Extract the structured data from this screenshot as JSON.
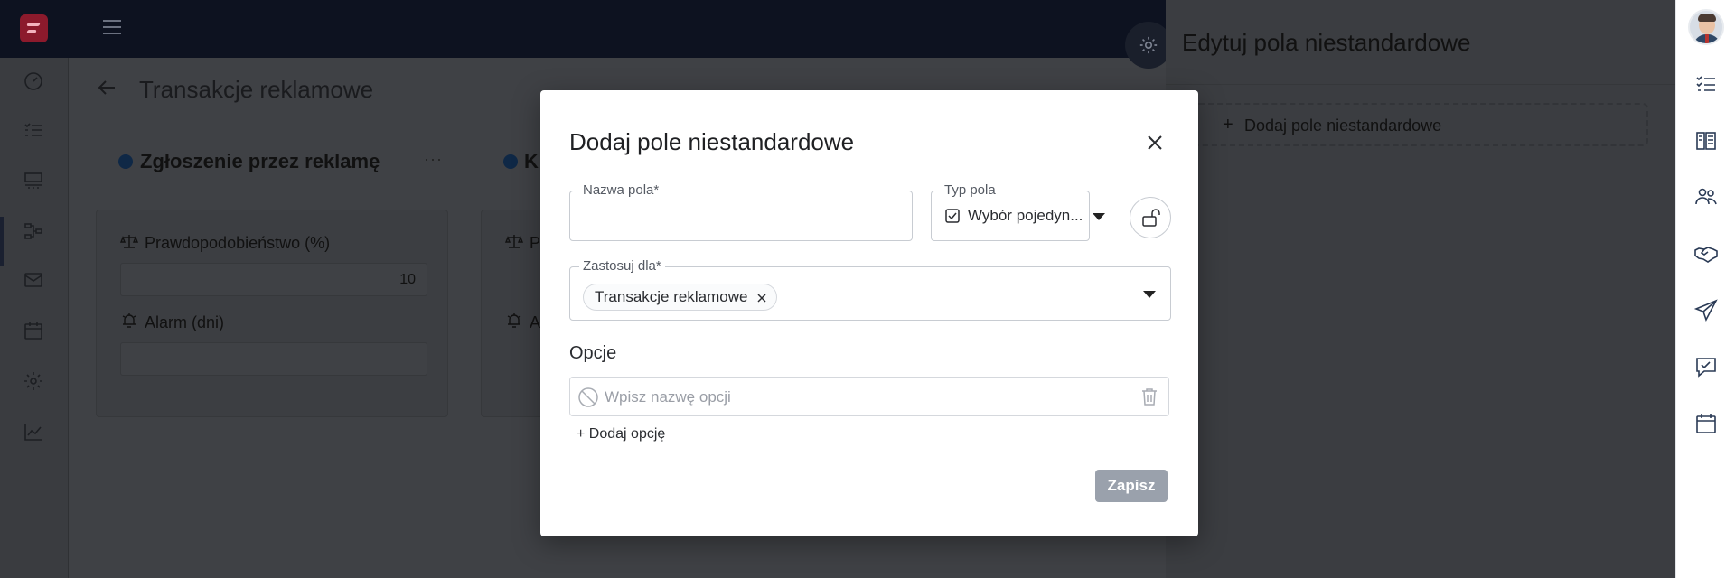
{
  "app": {
    "page_title": "Transakcje reklamowe",
    "columns": [
      {
        "title": "Zgłoszenie przez reklamę",
        "more": "···",
        "fields": [
          {
            "label": "Prawdopodobieństwo (%)",
            "value": "10",
            "icon": "scale-icon"
          },
          {
            "label": "Alarm (dni)",
            "value": "",
            "icon": "alarm-icon"
          }
        ]
      },
      {
        "title": "K",
        "fields": [
          {
            "label": "P",
            "icon": "scale-icon"
          },
          {
            "label": "A",
            "icon": "alarm-icon"
          }
        ]
      }
    ],
    "nav_icons": [
      "dashboard-icon",
      "checklist-icon",
      "board-icon",
      "flow-icon",
      "mail-icon",
      "calendar-icon",
      "settings-icon",
      "chart-icon"
    ]
  },
  "edit_panel": {
    "title": "Edytuj pola niestandardowe",
    "add_label": "Dodaj pole niestandardowe",
    "add_plus": "+"
  },
  "rail": {
    "icons": [
      "checklist-icon",
      "documents-icon",
      "contacts-icon",
      "handshake-icon",
      "send-icon",
      "task-icon",
      "calendar-icon"
    ]
  },
  "modal": {
    "title": "Dodaj pole niestandardowe",
    "field_name": {
      "label": "Nazwa pola*",
      "value": "",
      "placeholder": ""
    },
    "field_type": {
      "label": "Typ pola",
      "value": "Wybór pojedyn..."
    },
    "apply_to": {
      "label": "Zastosuj dla*",
      "chips": [
        "Transakcje reklamowe"
      ]
    },
    "options_label": "Opcje",
    "option_placeholder": "Wpisz nazwę opcji",
    "add_option": "+ Dodaj opcję",
    "save_label": "Zapisz"
  },
  "colors": {
    "modal_bg": "#ffffff",
    "save_button": "#9aa1ac",
    "topbar": "#0d1220",
    "overlay": "#3f4145"
  }
}
